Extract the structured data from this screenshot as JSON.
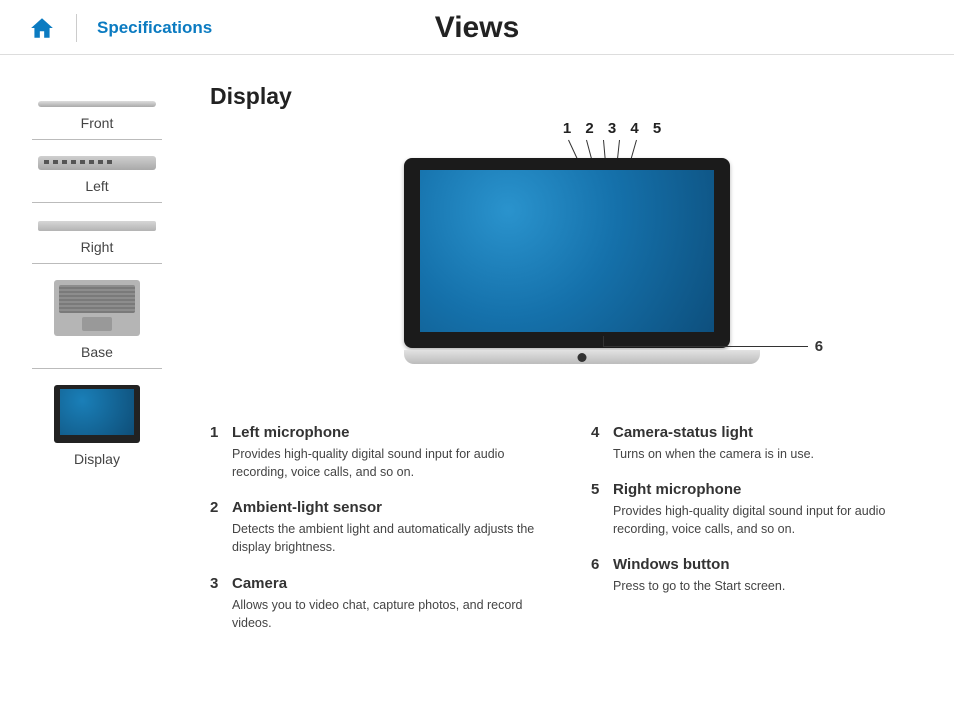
{
  "header": {
    "specifications_label": "Specifications",
    "page_title": "Views"
  },
  "sidebar": {
    "items": [
      {
        "label": "Front"
      },
      {
        "label": "Left"
      },
      {
        "label": "Right"
      },
      {
        "label": "Base"
      },
      {
        "label": "Display"
      }
    ]
  },
  "content": {
    "section_title": "Display",
    "callouts_top": [
      "1",
      "2",
      "3",
      "4",
      "5"
    ],
    "callout_right": "6",
    "descriptions_left": [
      {
        "num": "1",
        "title": "Left microphone",
        "text": "Provides high-quality digital sound input for audio recording, voice calls, and so on."
      },
      {
        "num": "2",
        "title": "Ambient-light sensor",
        "text": "Detects the ambient light and automatically adjusts the display brightness."
      },
      {
        "num": "3",
        "title": "Camera",
        "text": "Allows you to video chat, capture photos, and record videos."
      }
    ],
    "descriptions_right": [
      {
        "num": "4",
        "title": "Camera-status light",
        "text": "Turns on when the camera is in use."
      },
      {
        "num": "5",
        "title": "Right microphone",
        "text": "Provides high-quality digital sound input for audio recording, voice calls, and so on."
      },
      {
        "num": "6",
        "title": "Windows button",
        "text": "Press to go to the Start screen."
      }
    ]
  }
}
